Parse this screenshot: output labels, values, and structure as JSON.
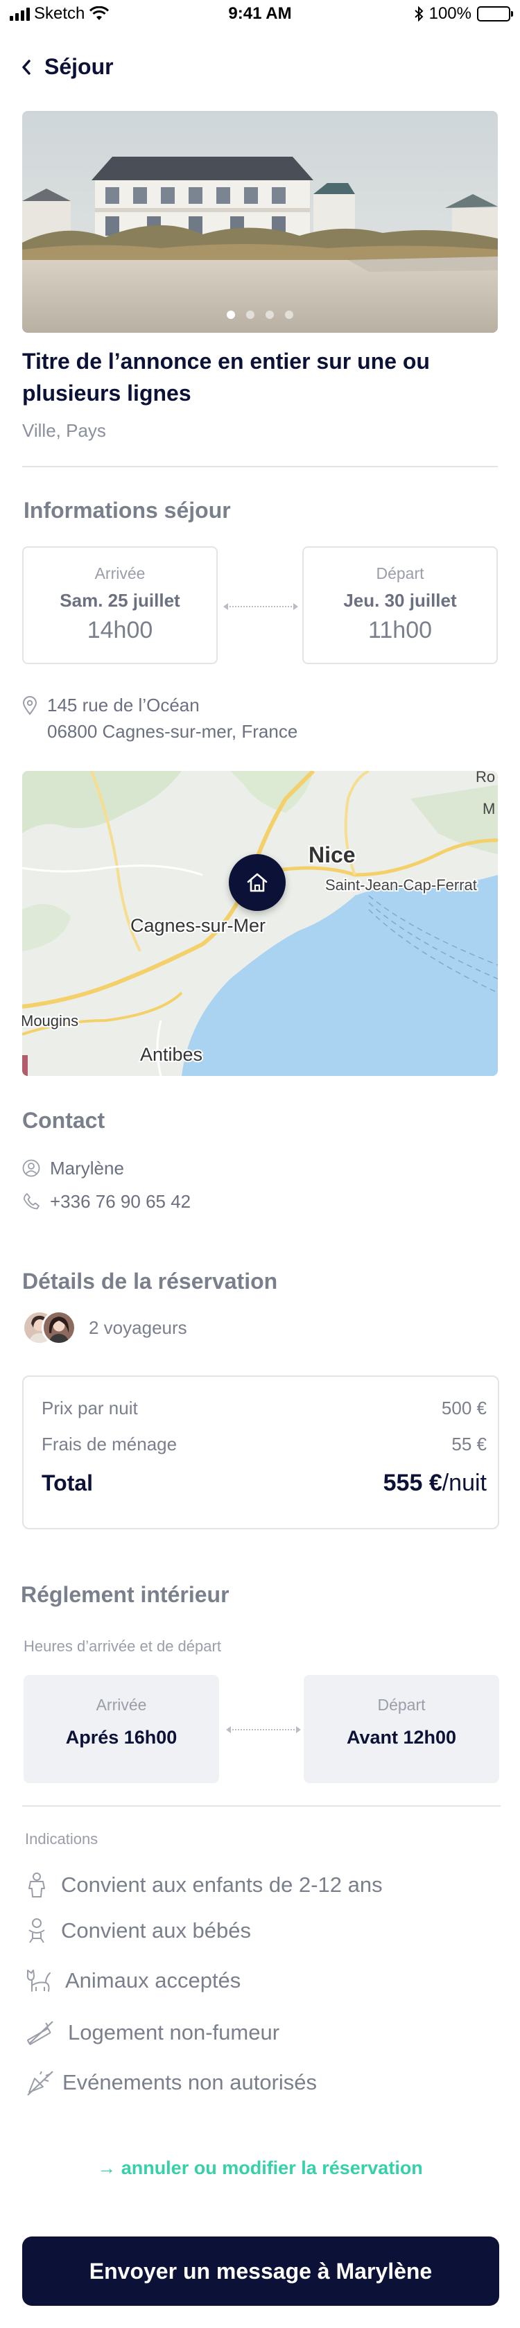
{
  "status_bar": {
    "carrier": "Sketch",
    "time": "9:41 AM",
    "battery": "100%"
  },
  "header": {
    "title": "Séjour"
  },
  "hero": {
    "photo_count": 4,
    "active_index": 0
  },
  "listing": {
    "title": "Titre de l’annonce en entier sur une ou plusieurs lignes",
    "location": "Ville, Pays"
  },
  "stay": {
    "section_title": "Informations séjour",
    "arrival": {
      "label": "Arrivée",
      "day": "Sam. 25 juillet",
      "time": "14h00"
    },
    "departure": {
      "label": "Départ",
      "day": "Jeu. 30 juillet",
      "time": "11h00"
    },
    "address_line1": "145 rue de l’Océan",
    "address_line2": "06800 Cagnes-sur-mer, France"
  },
  "map": {
    "labels": {
      "nice": "Nice",
      "cagnes": "Cagnes-sur-Mer",
      "saint_jean": "Saint-Jean-Cap-Ferrat",
      "antibes": "Antibes",
      "mougins": "Mougins",
      "ro": "Ro",
      "m": "M"
    }
  },
  "contact": {
    "section_title": "Contact",
    "name": "Marylène",
    "phone": "+336 76 90 65 42"
  },
  "booking": {
    "section_title": "Détails de la réservation",
    "travellers": "2 voyageurs",
    "price_per_night_label": "Prix par nuit",
    "price_per_night_value": "500 €",
    "cleaning_fee_label": "Frais de ménage",
    "cleaning_fee_value": "55 €",
    "total_label": "Total",
    "total_value": "555 €",
    "total_unit": "/nuit"
  },
  "rules": {
    "section_title": "Réglement intérieur",
    "times_label": "Heures d’arrivée et de départ",
    "arrival": {
      "label": "Arrivée",
      "value": "Aprés 16h00"
    },
    "departure": {
      "label": "Départ",
      "value": "Avant 12h00"
    },
    "indications_label": "Indications",
    "items": [
      {
        "icon": "child-icon",
        "label": "Convient aux enfants de 2-12 ans"
      },
      {
        "icon": "baby-icon",
        "label": "Convient aux bébés"
      },
      {
        "icon": "pet-icon",
        "label": "Animaux acceptés"
      },
      {
        "icon": "no-smoking-icon",
        "label": "Logement non-fumeur"
      },
      {
        "icon": "no-party-icon",
        "label": "Evénements non autorisés"
      }
    ]
  },
  "actions": {
    "cancel_link": "→ annuler ou modifier la réservation",
    "message_button": "Envoyer un message à Marylène"
  },
  "colors": {
    "primary": "#0b1137",
    "accent": "#36d1a9",
    "muted": "#7a7f8c",
    "border": "#e3e4e8"
  }
}
